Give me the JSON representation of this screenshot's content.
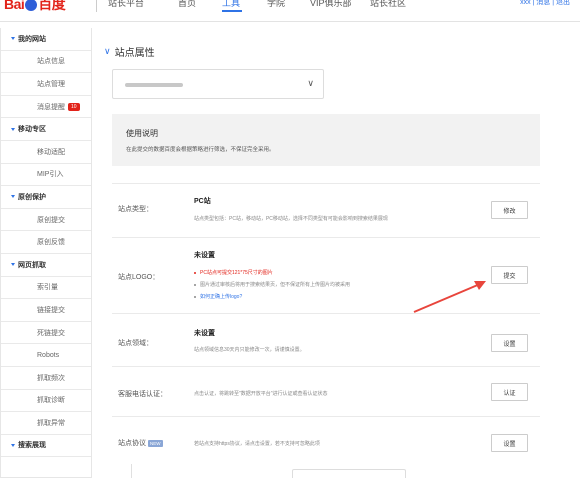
{
  "nav": {
    "logo_left": "Bai",
    "logo_right": "百度",
    "items": [
      "站长平台",
      "首页",
      "工具",
      "学院",
      "VIP俱乐部",
      "站长社区"
    ],
    "active_index": 2,
    "user": "xxx",
    "links": [
      "消息",
      "退出"
    ]
  },
  "sidebar": {
    "rows": [
      {
        "type": "group",
        "label": "我的网站"
      },
      {
        "type": "item",
        "label": "站点信息"
      },
      {
        "type": "item",
        "label": "站点管理"
      },
      {
        "type": "item",
        "label": "消息提醒",
        "badge": "10"
      },
      {
        "type": "group",
        "label": "移动专区"
      },
      {
        "type": "item",
        "label": "移动适配"
      },
      {
        "type": "item",
        "label": "MIP引入"
      },
      {
        "type": "group",
        "label": "原创保护"
      },
      {
        "type": "item",
        "label": "原创提交"
      },
      {
        "type": "item",
        "label": "原创反馈"
      },
      {
        "type": "group",
        "label": "网页抓取"
      },
      {
        "type": "item",
        "label": "索引量"
      },
      {
        "type": "item",
        "label": "链接提交"
      },
      {
        "type": "item",
        "label": "死链提交"
      },
      {
        "type": "item",
        "label": "Robots"
      },
      {
        "type": "item",
        "label": "抓取频次"
      },
      {
        "type": "item",
        "label": "抓取诊断"
      },
      {
        "type": "item",
        "label": "抓取异常"
      },
      {
        "type": "group",
        "label": "搜索展现"
      }
    ]
  },
  "main": {
    "title": "站点属性",
    "site_select": {
      "value": ""
    },
    "usage": {
      "title": "使用说明",
      "text": "在此提交的数据百度会根据策略进行筛选，不保证完全采用。"
    },
    "rows": [
      {
        "label": "站点类型：",
        "title": "PC站",
        "desc": "站点类型包括：PC站，移动站，PC移动站，选择不同类型有可能会影响到搜索结果展现",
        "button": "修改"
      },
      {
        "label": "站点LOGO：",
        "title": "未设置",
        "bullets": [
          {
            "style": "red",
            "text": "PC站点可提交121*75尺寸的图片"
          },
          {
            "style": "grey",
            "text": "图片通过审核后将用于搜索结果页，但不保证所有上传图片均被采用"
          },
          {
            "style": "blue",
            "text": "如何正确上传logo?"
          }
        ],
        "button": "提交"
      },
      {
        "label": "站点领域：",
        "title": "未设置",
        "desc": "站点领域信息30天内只能修改一次，请谨慎设置。",
        "button": "设置"
      },
      {
        "label": "客服电话认证：",
        "desc": "点击认证，将跳转至\"数据开放平台\"进行认证或查看认证状态",
        "button": "认证"
      },
      {
        "label": "站点协议",
        "label_tag": "NEW",
        "desc": "若站点支持https协议，请点击设置，若不支持可忽略此项",
        "button": "设置"
      }
    ]
  },
  "colors": {
    "accent": "#2f73e6",
    "brand": "#e2231a",
    "arrow": "#e8453c"
  }
}
